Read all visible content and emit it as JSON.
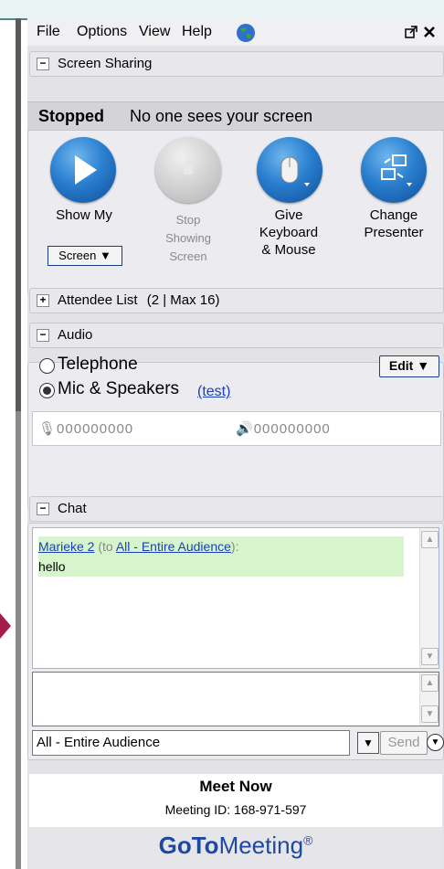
{
  "menu": {
    "items": [
      "File",
      "Options",
      "View",
      "Help"
    ],
    "globe_icon": "globe-icon",
    "window_buttons": [
      "popout-icon",
      "close-icon"
    ]
  },
  "screen_sharing": {
    "header": "Screen Sharing",
    "status_word": "Stopped",
    "status_message": "No one sees your screen",
    "show_my_label": "Show My",
    "screen_dropdown": "Screen ▼",
    "stop_label_1": "Stop",
    "stop_label_2": "Showing",
    "stop_label_3": "Screen",
    "give_label_1": "Give",
    "give_label_2": "Keyboard",
    "give_label_3": "& Mouse",
    "change_label_1": "Change",
    "change_label_2": "Presenter"
  },
  "attendee_list": {
    "header": "Attendee List",
    "count": "(2 | Max 16)"
  },
  "audio": {
    "header": "Audio",
    "telephone_label": "Telephone",
    "mic_label": "Mic & Speakers",
    "test_link": "(test)",
    "edit_button": "Edit ▼",
    "selected": "Mic & Speakers",
    "mic_meter": "000000000",
    "speaker_meter": "000000000"
  },
  "chat": {
    "header": "Chat",
    "message": {
      "sender": "Marieke 2",
      "to_prefix": "(to",
      "recipient": "All - Entire Audience",
      "to_suffix": "):",
      "text": "hello"
    },
    "recipient_select": "All - Entire Audience",
    "send_button": "Send"
  },
  "meeting": {
    "title": "Meet Now",
    "id": "Meeting ID: 168-971-597",
    "logo_bold": "GoTo",
    "logo_rest": "Meeting",
    "logo_mark": "®"
  },
  "colors": {
    "accent_blue": "#1d4aa0",
    "chat_highlight": "#d7f5cc",
    "arrow": "#a31c4b"
  }
}
